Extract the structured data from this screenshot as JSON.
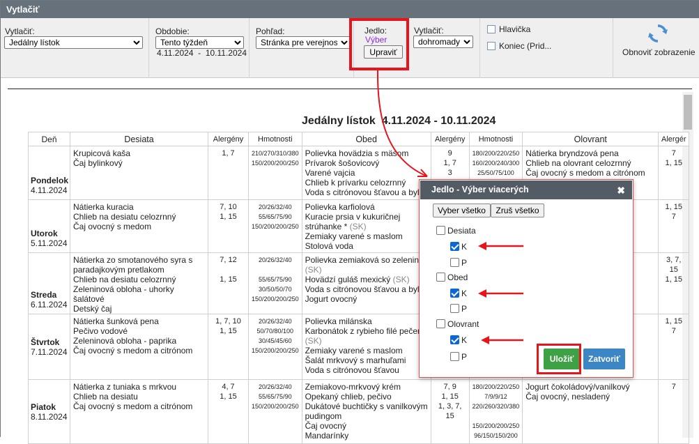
{
  "window": {
    "title": "Vytlačiť"
  },
  "toolbar": {
    "print_label": "Vytlačiť:",
    "print_value": "Jedálny lístok",
    "period_label": "Obdobie:",
    "period_value": "Tento týždeň",
    "period_range": "4.11.2024  -  10.11.2024",
    "view_label": "Pohľad:",
    "view_value": "Stránka pre verejnosť",
    "meal_label": "Jedlo:",
    "meal_link": "Výber",
    "edit_button": "Upraviť",
    "print2_label": "Vytlačiť:",
    "print2_value": "dohromady",
    "header_check": "Hlavička",
    "footer_check": "Koniec (Prid...",
    "refresh_label": "Obnoviť zobrazenie"
  },
  "report": {
    "title": "Jedálny lístok  4.11.2024 - 10.11.2024",
    "columns": [
      "Deň",
      "Desiata",
      "Alergény",
      "Hmotnosti",
      "Obed",
      "Alergény",
      "Hmotnosti",
      "Olovrant",
      "Alergér"
    ],
    "rows": [
      {
        "day": "Pondelok",
        "date": "4.11.2024",
        "desiata": [
          "Krupicová kaša",
          "Čaj bylinkový"
        ],
        "desiata_al": [
          "1, 7",
          ""
        ],
        "desiata_hm": [
          "210/270/310/380",
          "150/200/200/250"
        ],
        "obed": [
          "Polievka hovädzia s mäsom",
          "Prívarok šošovicový",
          "Varené vajcia",
          "Chlieb k prívarku celozrnný",
          "Voda s citrónovou šťavou a bylin"
        ],
        "obed_al": [
          "9",
          "1, 7",
          "3",
          "",
          ""
        ],
        "obed_hm": [
          "180/200/220/250",
          "160/200/240/300",
          "25/50/75/100",
          "",
          ""
        ],
        "olovrant": [
          "Nátierka bryndzová pena",
          "Chlieb na olovrant celozrnný",
          "Čaj ovocný s medom a citrónom"
        ],
        "olovrant_al": [
          "7",
          "1, 15",
          ""
        ]
      },
      {
        "day": "Utorok",
        "date": "5.11.2024",
        "desiata": [
          "Nátierka kuracia",
          "Chlieb na desiatu celozrnný",
          "Čaj ovocný s medom"
        ],
        "desiata_al": [
          "7, 10",
          "1, 15",
          ""
        ],
        "desiata_hm": [
          "20/26/32/40",
          "55/65/75/90",
          "150/200/200/250"
        ],
        "obed": [
          "Polievka karfiolová",
          "Kuracie prsia v kukuričnej",
          "strúhanke *",
          "Zemiaky varené s maslom",
          "Stolová voda"
        ],
        "obed_sk": "(SK)",
        "olovrant_al": [
          "1, 15",
          "7"
        ]
      },
      {
        "day": "Streda",
        "date": "6.11.2024",
        "desiata": [
          "Nátierka zo smotanového syra s",
          "paradajkovým pretlakom",
          "Chlieb na desiatu celozrnný",
          "Zeleninová obloha - uhorky šalátové",
          "Detský čaj"
        ],
        "desiata_al": [
          "7, 12",
          "",
          "1, 15",
          "",
          ""
        ],
        "desiata_hm": [
          "20/26/32/40",
          "",
          "55/65/75/90",
          "30/50/50/70",
          "150/200/200/250"
        ],
        "obed": [
          "Polievka zemiaková so zelenino",
          "(SK)",
          "Hovädzí guláš mexický",
          "Voda s citrónovou šťavou a bylin",
          "Jogurt ovocný"
        ],
        "obed_sk": "(SK)",
        "olovrant_al": [
          "3, 7, 15",
          "1, 15"
        ]
      },
      {
        "day": "Štvrtok",
        "date": "7.11.2024",
        "desiata": [
          "Nátierka šunková pena",
          "Pečivo vodové",
          "Zeleninová obloha - paprika",
          "Čaj ovocný s medom a citrónom"
        ],
        "desiata_al": [
          "1, 7, 10",
          "1, 15",
          "",
          ""
        ],
        "desiata_hm": [
          "20/26/32/40",
          "50/70/80/100",
          "30/45/45/60",
          "150/200/200/250"
        ],
        "obed": [
          "Polievka milánska",
          "Karbonátok z rybieho filé pečen",
          "(SK)",
          "Zemiaky varené s maslom",
          "Šalát mrkvový s marhuľami",
          "Voda s citrónovou šťavou"
        ],
        "olovrant_al": [
          "1, 15",
          "7"
        ]
      },
      {
        "day": "Piatok",
        "date": "8.11.2024",
        "desiata": [
          "Nátierka z tuniaka s mrkvou",
          "Chlieb na desiatu",
          "Čaj ovocný s medom a citrónom"
        ],
        "desiata_al": [
          "4, 7",
          "1, 15",
          ""
        ],
        "desiata_hm": [
          "20/26/32/40",
          "55/65/75/90",
          "150/200/200/250"
        ],
        "obed": [
          "Zemiakovo-mrkvový krém",
          "Opekaný chlieb, pečivo",
          "Dukátové buchtičky s vanilkovým",
          "pudingom",
          "Čaj ovocný",
          "Mandarínky"
        ],
        "obed_al": [
          "7, 9",
          "1, 15",
          "1, 3, 7, 15",
          "",
          "",
          ""
        ],
        "obed_hm": [
          "180/200/220/250",
          "7/9/9/12",
          "220/260/320/380",
          "",
          "150/200/200/250",
          "96/150/150/200"
        ],
        "olovrant": [
          "Jogurt čokoládový/vanilkový",
          "Čaj ovocný, nesladený"
        ],
        "olovrant_al": [
          "7",
          ""
        ]
      }
    ]
  },
  "dialog": {
    "title": "Jedlo - Výber viacerých",
    "select_all": "Vyber všetko",
    "clear_all": "Zruš všetko",
    "groups": [
      {
        "label": "Desiata",
        "checked": false,
        "items": [
          {
            "label": "K",
            "checked": true
          },
          {
            "label": "P",
            "checked": false
          }
        ]
      },
      {
        "label": "Obed",
        "checked": false,
        "items": [
          {
            "label": "K",
            "checked": true
          },
          {
            "label": "P",
            "checked": false
          }
        ]
      },
      {
        "label": "Olovrant",
        "checked": false,
        "items": [
          {
            "label": "K",
            "checked": true
          },
          {
            "label": "P",
            "checked": false
          }
        ]
      }
    ],
    "save": "Uložiť",
    "close": "Zatvoriť"
  },
  "colors": {
    "titlebar": "#66717c",
    "dialog_header": "#535c64",
    "save": "#3fa145",
    "close": "#3d86c6",
    "annotation": "#e8141c",
    "link": "#8a2be2"
  }
}
